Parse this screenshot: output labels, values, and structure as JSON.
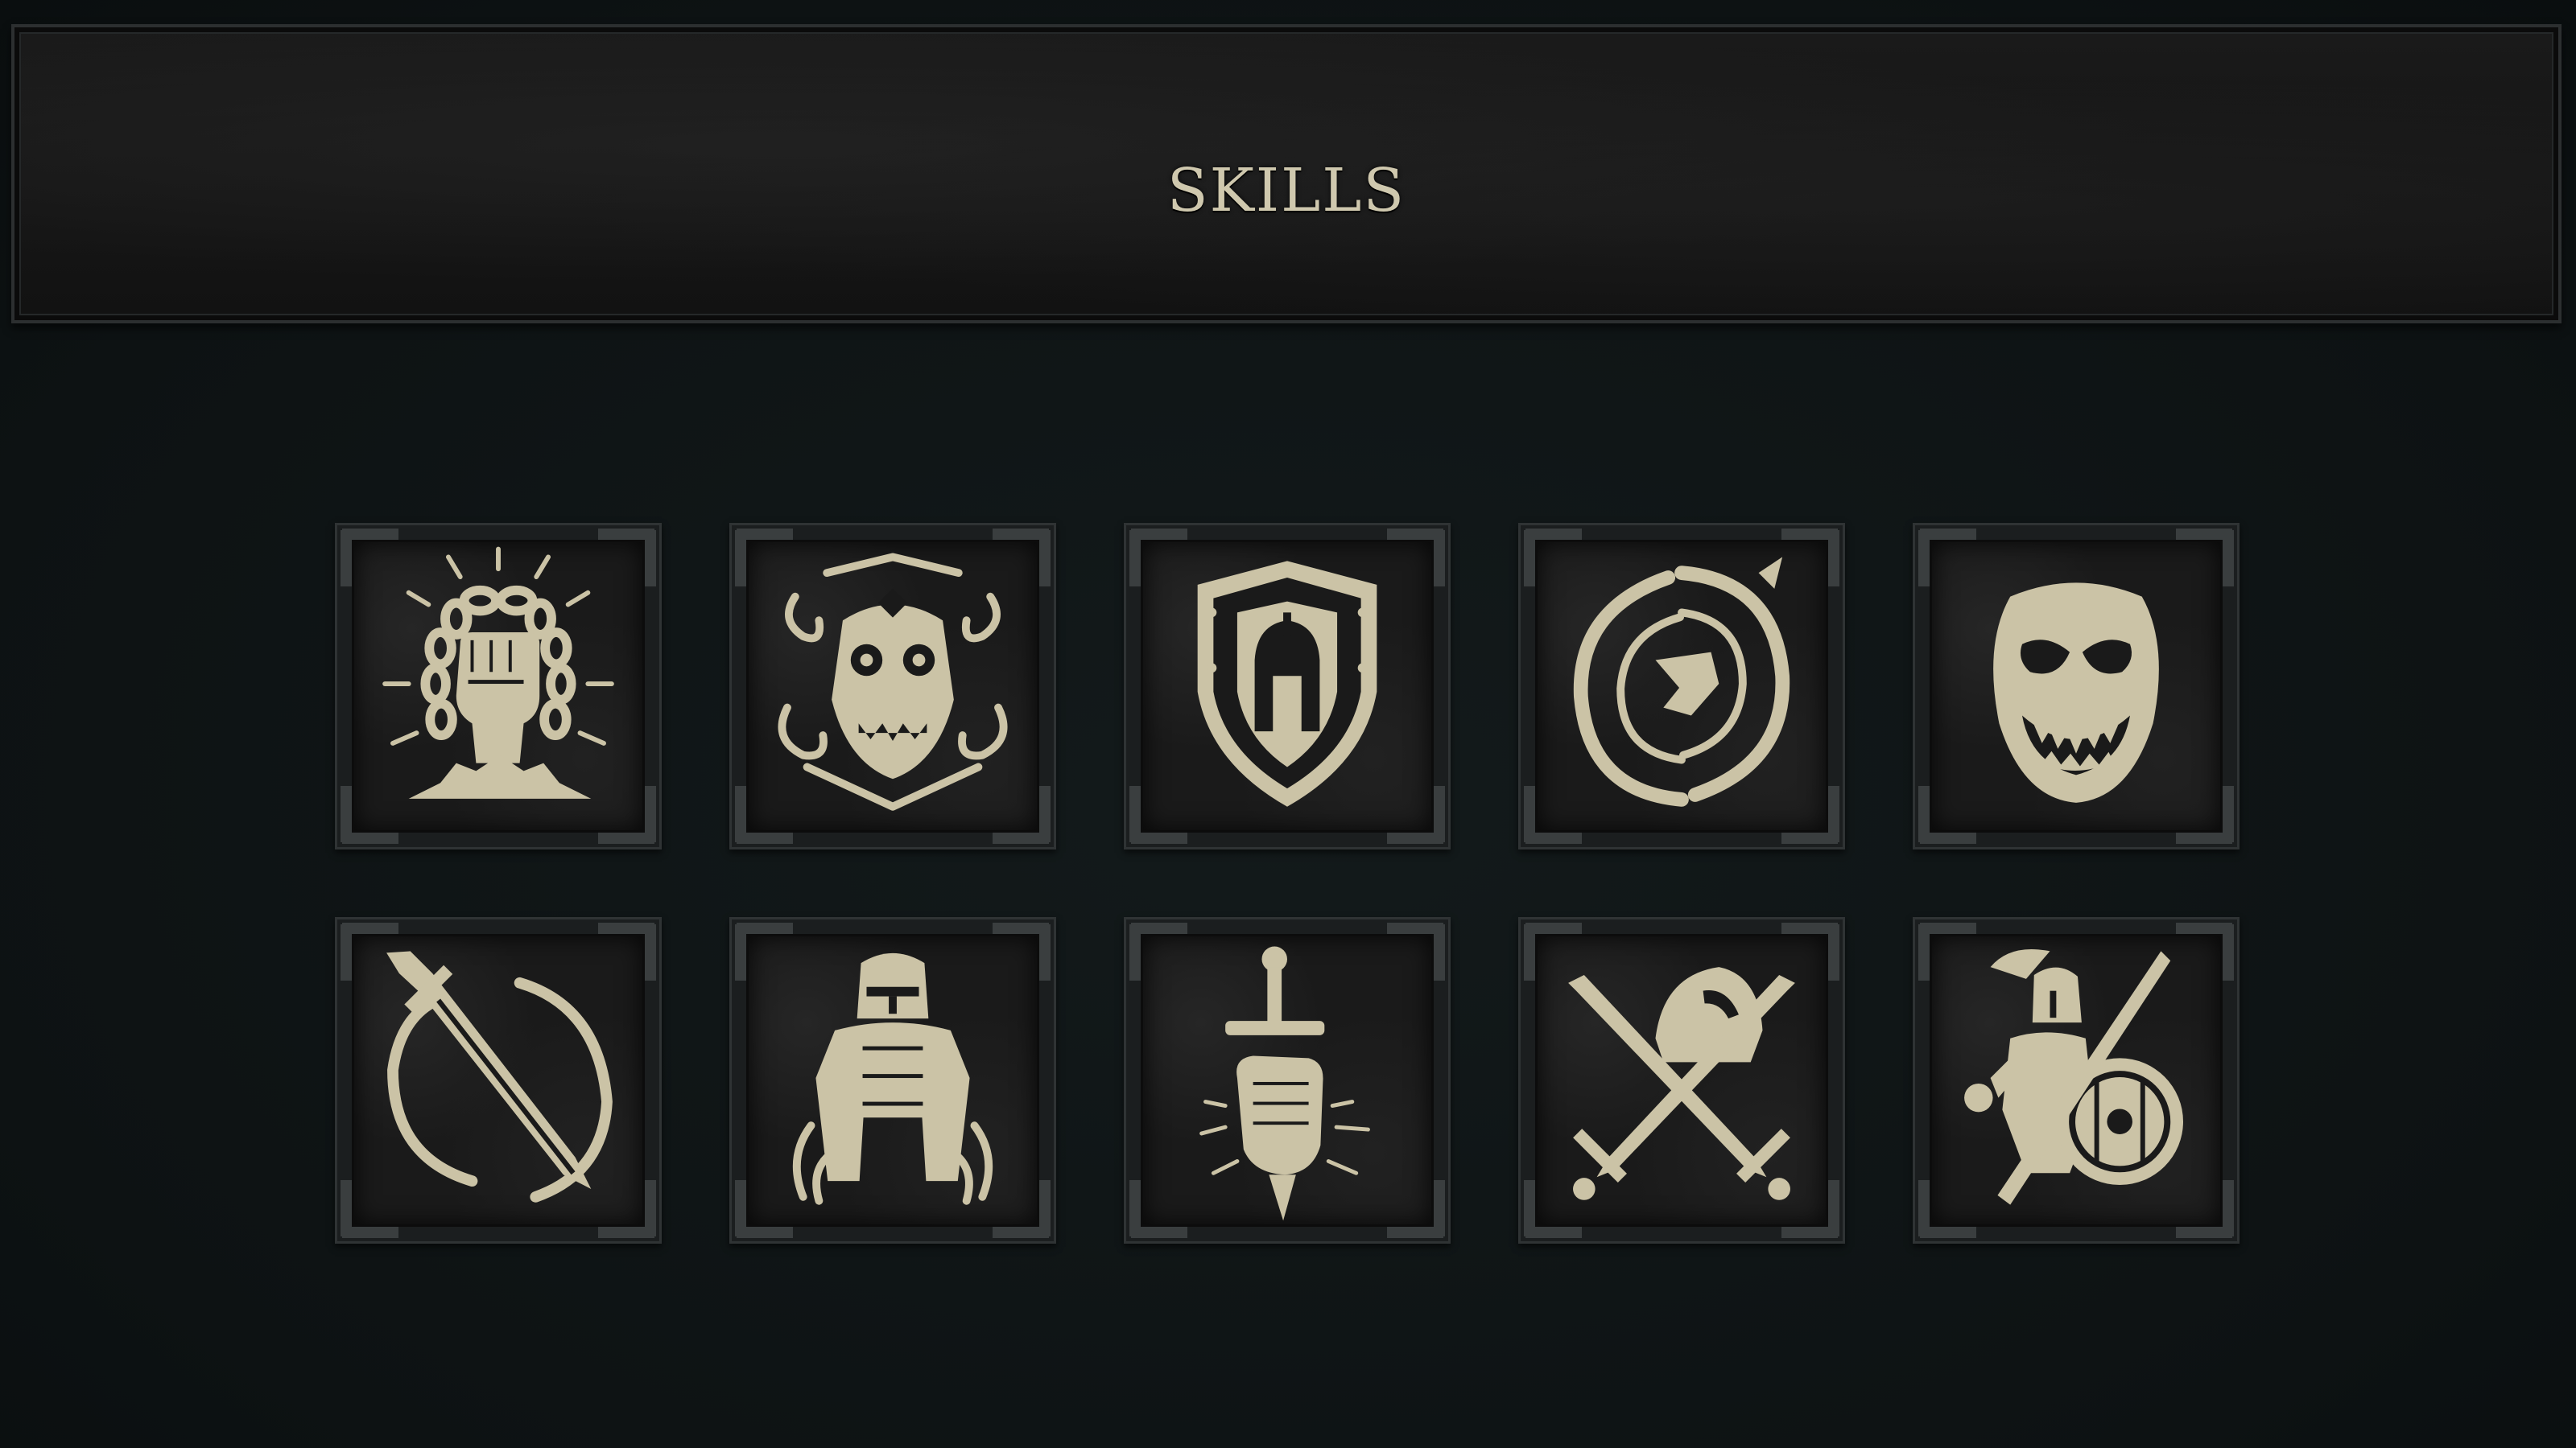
{
  "header": {
    "title": "SKILLS"
  },
  "colors": {
    "background": "#111718",
    "banner": "#141414",
    "icon": "#cbc3a6",
    "frame": "#2f3334"
  },
  "skills": [
    {
      "row": 1,
      "icon": "chained-fist-icon"
    },
    {
      "row": 1,
      "icon": "demon-mask-smoke-icon"
    },
    {
      "row": 1,
      "icon": "spartan-shield-icon"
    },
    {
      "row": 1,
      "icon": "dragon-vortex-icon"
    },
    {
      "row": 1,
      "icon": "grinning-mask-icon"
    },
    {
      "row": 2,
      "icon": "flaming-sword-icon"
    },
    {
      "row": 2,
      "icon": "armored-knight-icon"
    },
    {
      "row": 2,
      "icon": "hand-dagger-icon"
    },
    {
      "row": 2,
      "icon": "crossed-swords-helmet-icon"
    },
    {
      "row": 2,
      "icon": "spartan-warrior-icon"
    }
  ]
}
